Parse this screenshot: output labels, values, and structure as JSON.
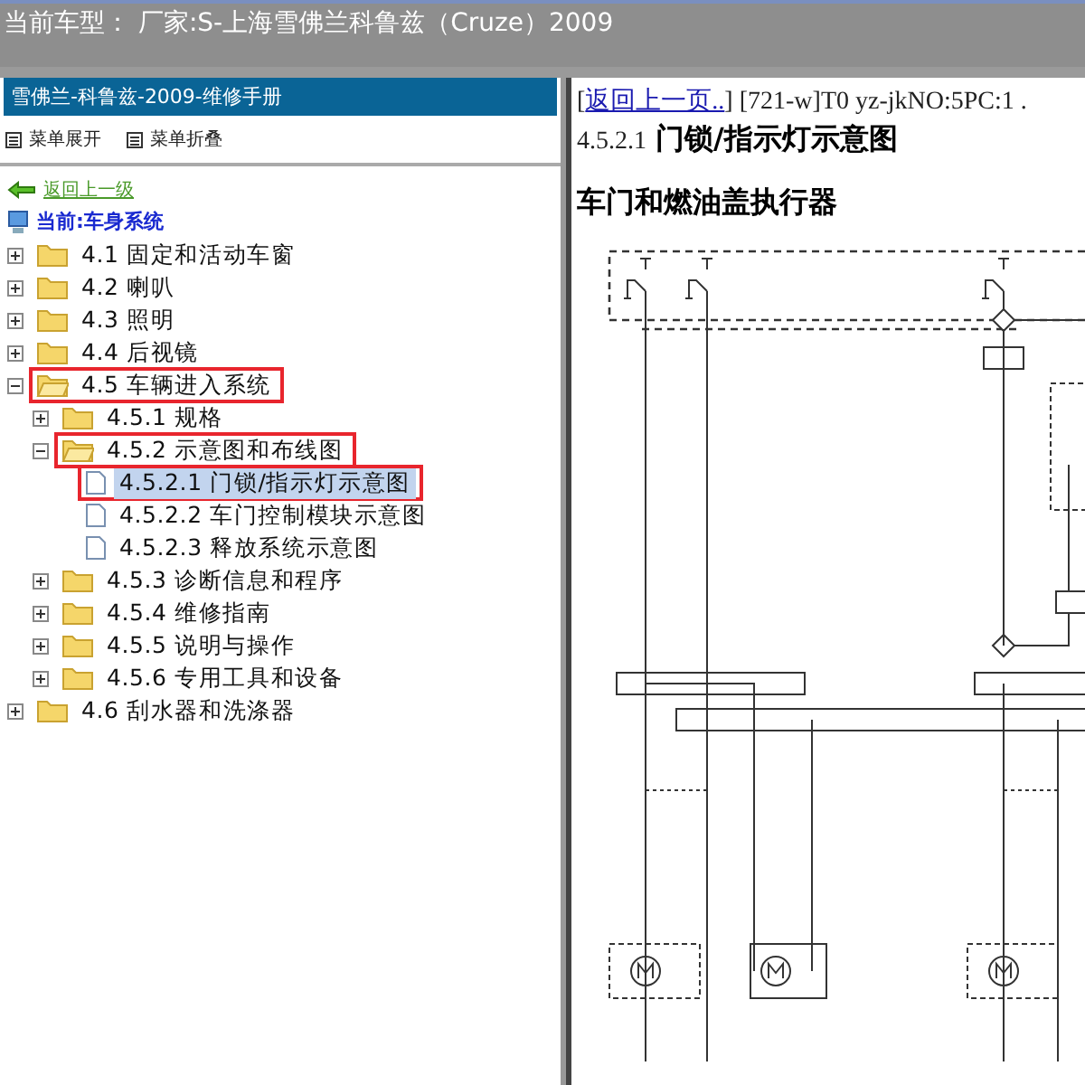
{
  "window": {
    "title": "当前车型： 厂家:S-上海雪佛兰科鲁兹（Cruze）2009"
  },
  "sidebar": {
    "header": "雪佛兰-科鲁兹-2009-维修手册",
    "toolbar": [
      "菜单展开",
      "菜单折叠"
    ],
    "back_link": "返回上一级",
    "current": "当前:车身系统",
    "tree": [
      {
        "kind": "folder",
        "label": "4.1 固定和活动车窗",
        "expanded": false,
        "selected": false,
        "highlighted": false
      },
      {
        "kind": "folder",
        "label": "4.2 喇叭",
        "expanded": false,
        "selected": false,
        "highlighted": false
      },
      {
        "kind": "folder",
        "label": "4.3 照明",
        "expanded": false,
        "selected": false,
        "highlighted": false
      },
      {
        "kind": "folder",
        "label": "4.4 后视镜",
        "expanded": false,
        "selected": false,
        "highlighted": false
      },
      {
        "kind": "folder",
        "label": "4.5 车辆进入系统",
        "expanded": true,
        "selected": false,
        "highlighted": true,
        "children": [
          {
            "kind": "folder",
            "label": "4.5.1 规格",
            "expanded": false,
            "selected": false,
            "highlighted": false
          },
          {
            "kind": "folder",
            "label": "4.5.2 示意图和布线图",
            "expanded": true,
            "selected": false,
            "highlighted": true,
            "children": [
              {
                "kind": "page",
                "label": "4.5.2.1 门锁/指示灯示意图",
                "selected": true,
                "highlighted": true
              },
              {
                "kind": "page",
                "label": "4.5.2.2 车门控制模块示意图",
                "selected": false,
                "highlighted": false
              },
              {
                "kind": "page",
                "label": "4.5.2.3 释放系统示意图",
                "selected": false,
                "highlighted": false
              }
            ]
          },
          {
            "kind": "folder",
            "label": "4.5.3 诊断信息和程序",
            "expanded": false,
            "selected": false,
            "highlighted": false
          },
          {
            "kind": "folder",
            "label": "4.5.4 维修指南",
            "expanded": false,
            "selected": false,
            "highlighted": false
          },
          {
            "kind": "folder",
            "label": "4.5.5 说明与操作",
            "expanded": false,
            "selected": false,
            "highlighted": false
          },
          {
            "kind": "folder",
            "label": "4.5.6 专用工具和设备",
            "expanded": false,
            "selected": false,
            "highlighted": false
          }
        ]
      },
      {
        "kind": "folder",
        "label": "4.6 刮水器和洗涤器",
        "expanded": false,
        "selected": false,
        "highlighted": false
      }
    ]
  },
  "document": {
    "link_prefix": "[",
    "back_link": "返回上一页..",
    "link_suffix": "]",
    "reference": "[721-w]T0 yz-jkNO:5PC:1 .",
    "heading_number": "4.5.2.1",
    "heading": "门锁/指示灯示意图",
    "subheading": "车门和燃油盖执行器"
  }
}
